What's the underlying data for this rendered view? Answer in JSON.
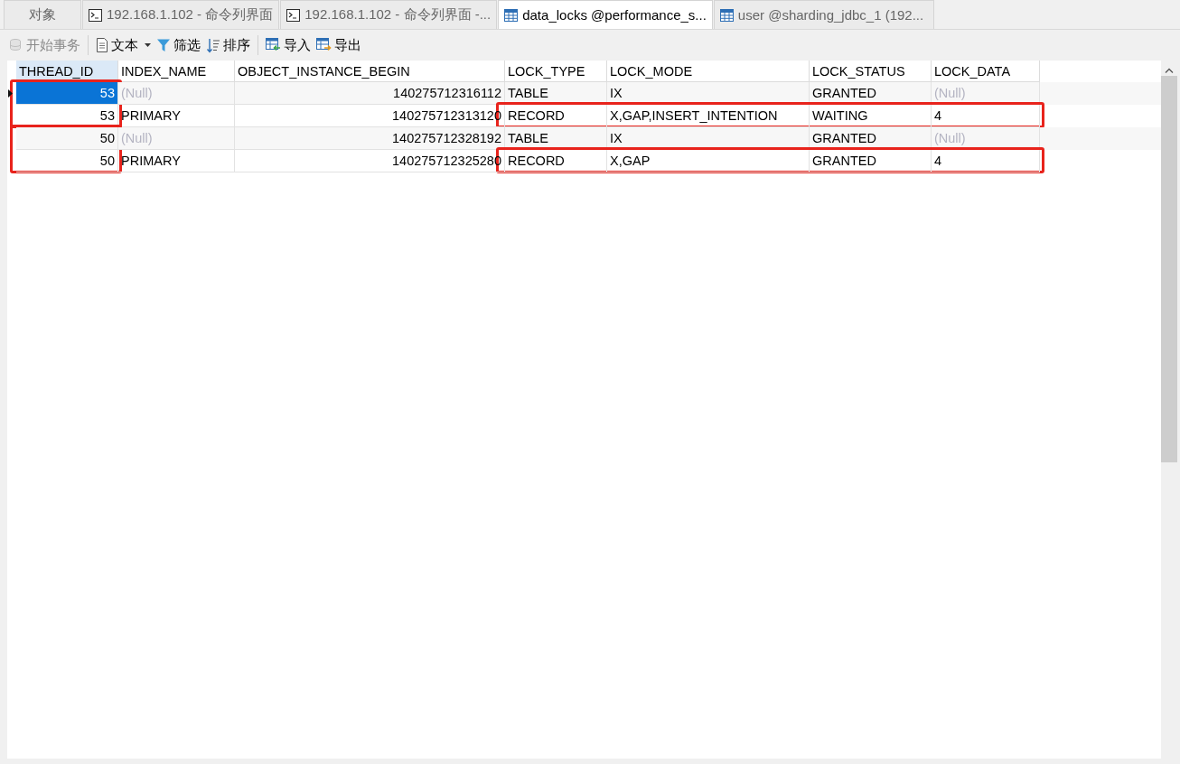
{
  "tabs": [
    {
      "label": "对象",
      "kind": "plain",
      "selected": false
    },
    {
      "label": "192.168.1.102 - 命令列界面",
      "kind": "console",
      "selected": false
    },
    {
      "label": "192.168.1.102 - 命令列界面 -...",
      "kind": "console",
      "selected": false
    },
    {
      "label": "data_locks @performance_s...",
      "kind": "table",
      "selected": true
    },
    {
      "label": "user @sharding_jdbc_1 (192...",
      "kind": "table",
      "selected": false
    }
  ],
  "toolbar": [
    [
      {
        "label": "开始事务",
        "kind": "transaction",
        "disabled": true
      }
    ],
    [
      {
        "label": "文本",
        "kind": "text",
        "disabled": false
      },
      {
        "label": "筛选",
        "kind": "filter",
        "disabled": false
      },
      {
        "label": "排序",
        "kind": "sort",
        "disabled": false
      }
    ],
    [
      {
        "label": "导入",
        "kind": "import",
        "disabled": false
      },
      {
        "label": "导出",
        "kind": "export",
        "disabled": false
      }
    ]
  ],
  "table": {
    "columns": [
      {
        "label": "THREAD_ID",
        "kind": "number",
        "selected": true
      },
      {
        "label": "INDEX_NAME",
        "kind": "text",
        "selected": false
      },
      {
        "label": "OBJECT_INSTANCE_BEGIN",
        "kind": "number",
        "selected": false
      },
      {
        "label": "LOCK_TYPE",
        "kind": "text",
        "selected": false
      },
      {
        "label": "LOCK_MODE",
        "kind": "text",
        "selected": false
      },
      {
        "label": "LOCK_STATUS",
        "kind": "text",
        "selected": false
      },
      {
        "label": "LOCK_DATA",
        "kind": "text",
        "selected": false
      }
    ],
    "rows": [
      {
        "selected": true,
        "thread_frame": true,
        "lock_frame": false,
        "cells": [
          {
            "text": "53",
            "kind": "value"
          },
          {
            "text": "(Null)",
            "kind": "null"
          },
          {
            "text": "140275712316112",
            "kind": "value"
          },
          {
            "text": "TABLE",
            "kind": "value"
          },
          {
            "text": "IX",
            "kind": "value"
          },
          {
            "text": "GRANTED",
            "kind": "value"
          },
          {
            "text": "(Null)",
            "kind": "null"
          }
        ]
      },
      {
        "selected": false,
        "thread_frame": false,
        "lock_frame": true,
        "cells": [
          {
            "text": "53",
            "kind": "value"
          },
          {
            "text": "PRIMARY",
            "kind": "value"
          },
          {
            "text": "140275712313120",
            "kind": "value"
          },
          {
            "text": "RECORD",
            "kind": "value"
          },
          {
            "text": "X,GAP,INSERT_INTENTION",
            "kind": "value"
          },
          {
            "text": "WAITING",
            "kind": "value"
          },
          {
            "text": "4",
            "kind": "value"
          }
        ]
      },
      {
        "selected": false,
        "thread_frame": true,
        "lock_frame": false,
        "cells": [
          {
            "text": "50",
            "kind": "value"
          },
          {
            "text": "(Null)",
            "kind": "null"
          },
          {
            "text": "140275712328192",
            "kind": "value"
          },
          {
            "text": "TABLE",
            "kind": "value"
          },
          {
            "text": "IX",
            "kind": "value"
          },
          {
            "text": "GRANTED",
            "kind": "value"
          },
          {
            "text": "(Null)",
            "kind": "null"
          }
        ]
      },
      {
        "selected": false,
        "thread_frame": false,
        "lock_frame": true,
        "cells": [
          {
            "text": "50",
            "kind": "value"
          },
          {
            "text": "PRIMARY",
            "kind": "value"
          },
          {
            "text": "140275712325280",
            "kind": "value"
          },
          {
            "text": "RECORD",
            "kind": "value"
          },
          {
            "text": "X,GAP",
            "kind": "value"
          },
          {
            "text": "GRANTED",
            "kind": "value"
          },
          {
            "text": "4",
            "kind": "value"
          }
        ]
      }
    ]
  }
}
